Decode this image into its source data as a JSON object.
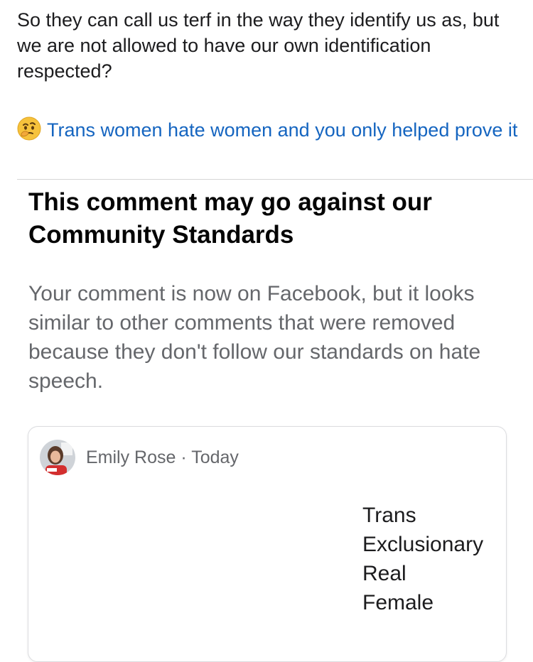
{
  "post": {
    "text": "So they can call us terf in the way they identify us as, but we are not allowed to have our own identification respected?",
    "reply_emoji": "thinking-face-emoji",
    "reply_text": "Trans women hate women and you only helped prove it",
    "reply_color": "#1565c0"
  },
  "warning": {
    "title": "This comment may go against our Community Standards",
    "body": "Your comment is now on Facebook, but it looks similar to other comments that were removed because they don't follow our standards on hate speech."
  },
  "comment_card": {
    "author": "Emily Rose",
    "separator": "·",
    "time": "Today",
    "lines": [
      "Trans",
      "Exclusionary",
      "Real",
      "Female"
    ]
  }
}
